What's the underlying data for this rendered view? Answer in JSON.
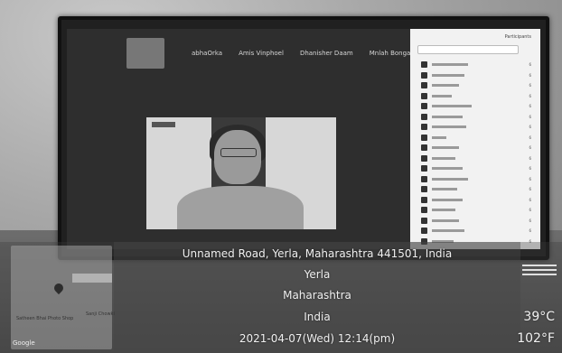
{
  "meeting": {
    "participants": [
      "abhaOrka",
      "Amis Vinphoel",
      "Dhanisher Daam",
      "Mnlah Bongale"
    ],
    "speaker_caption": "",
    "panel_title": "Participants",
    "participant_rows": [
      {
        "stat": "6"
      },
      {
        "stat": "6"
      },
      {
        "stat": "6"
      },
      {
        "stat": "6"
      },
      {
        "stat": "6"
      },
      {
        "stat": "6"
      },
      {
        "stat": "6"
      },
      {
        "stat": "6"
      },
      {
        "stat": "6"
      },
      {
        "stat": "6"
      },
      {
        "stat": "6"
      },
      {
        "stat": "6"
      },
      {
        "stat": "6"
      },
      {
        "stat": "6"
      },
      {
        "stat": "6"
      },
      {
        "stat": "6"
      },
      {
        "stat": "6"
      },
      {
        "stat": "6"
      }
    ]
  },
  "geo": {
    "address": "Unnamed Road, Yerla, Maharashtra 441501, India",
    "locality": "Yerla",
    "state": "Maharashtra",
    "country": "India",
    "datetime": "2021-04-07(Wed)  12:14(pm)"
  },
  "weather": {
    "celsius": "39°C",
    "fahrenheit": "102°F"
  },
  "map": {
    "label_left": "Satheen Bhai\nPhoto Shop",
    "label_right": "Sanji\nChowki",
    "brand": "Google"
  },
  "icons": [
    "info-icon",
    "map-pin-icon",
    "wind-icon"
  ]
}
